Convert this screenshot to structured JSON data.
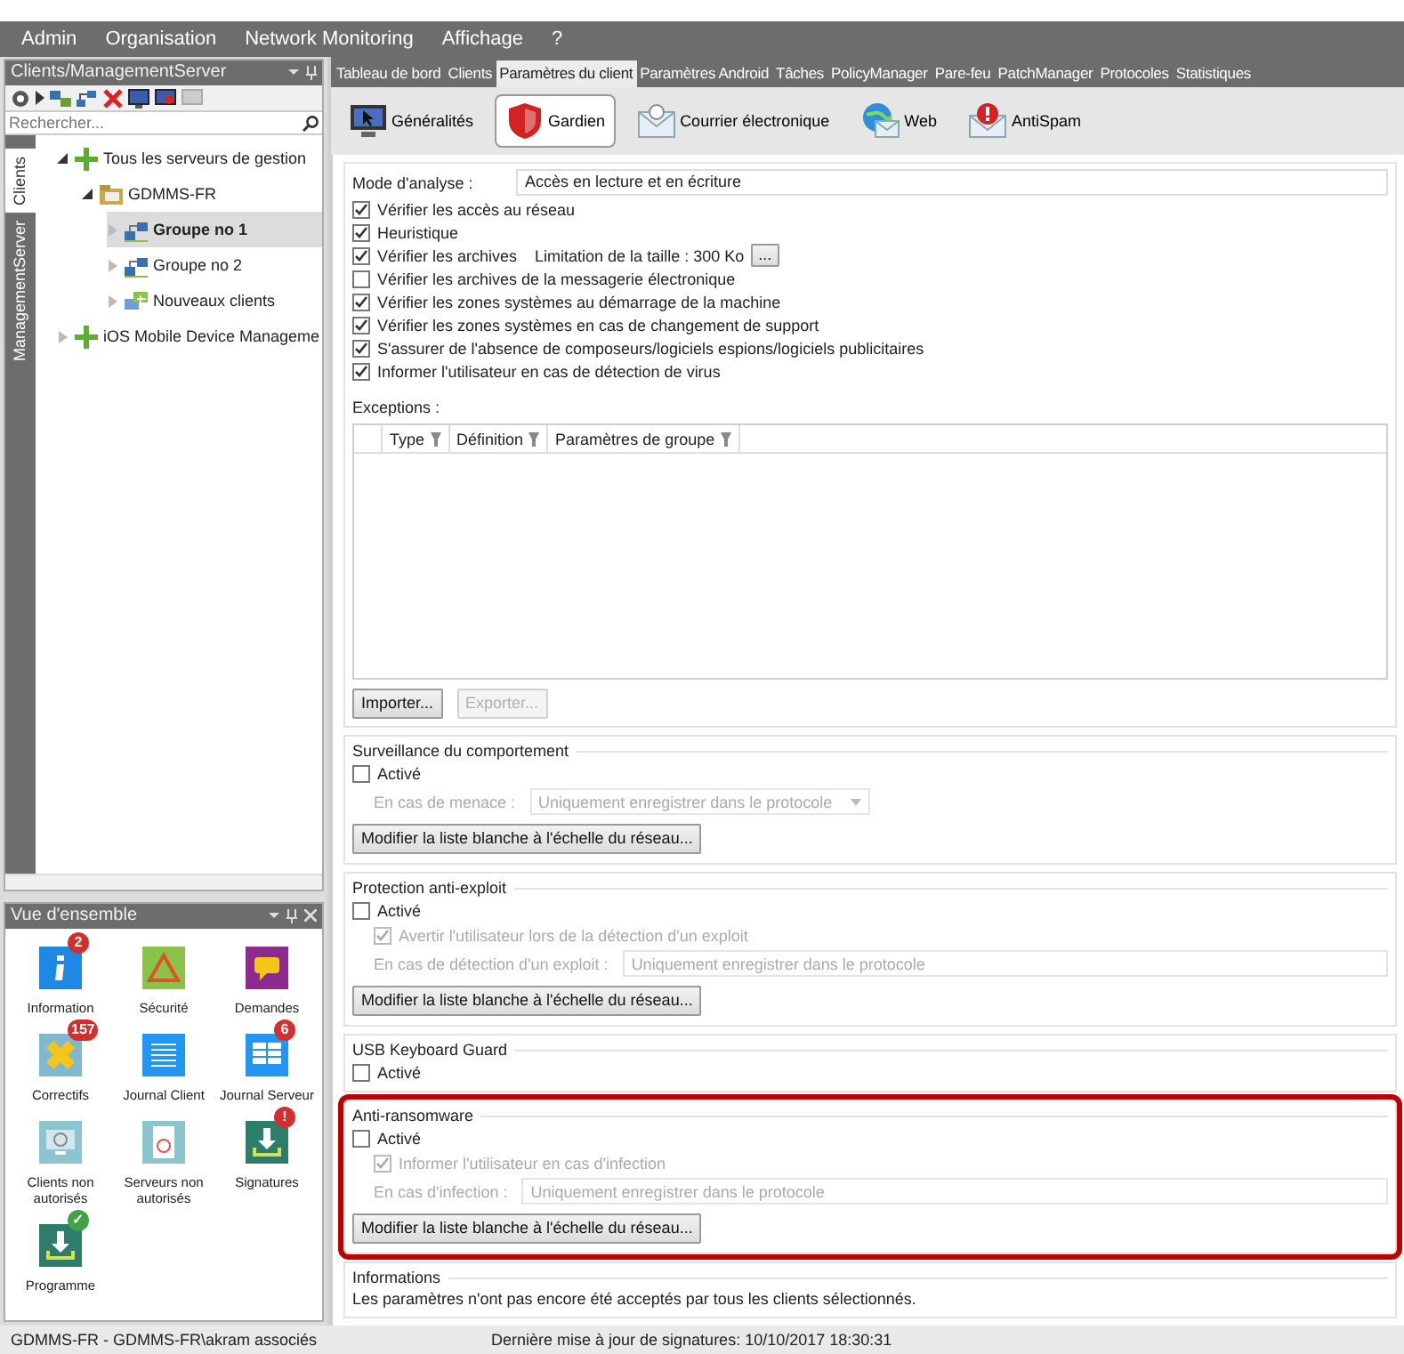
{
  "menu": [
    "Admin",
    "Organisation",
    "Network Monitoring",
    "Affichage",
    "?"
  ],
  "clients_panel": {
    "title": "Clients/ManagementServer",
    "search": {
      "placeholder": "Rechercher..."
    },
    "side_tabs": [
      {
        "label": "Clients",
        "selected": true
      },
      {
        "label": "ManagementServer",
        "selected": false
      }
    ],
    "tree": [
      {
        "label": "Tous les serveurs de gestion",
        "kind": "server-group",
        "expanded": true,
        "selected": false,
        "children": [
          {
            "label": "GDMMS-FR",
            "kind": "folder",
            "expanded": true,
            "selected": false,
            "children": [
              {
                "label": "Groupe no 1",
                "kind": "group",
                "expanded": false,
                "selected": true
              },
              {
                "label": "Groupe no 2",
                "kind": "group",
                "expanded": false,
                "selected": false
              },
              {
                "label": "Nouveaux clients",
                "kind": "new-clients",
                "expanded": false,
                "selected": false
              }
            ]
          }
        ]
      },
      {
        "label": "iOS Mobile Device Manageme",
        "kind": "server-group",
        "expanded": false,
        "selected": false
      }
    ]
  },
  "overview_panel": {
    "title": "Vue d'ensemble",
    "tiles": [
      {
        "label": "Information",
        "kind": "info",
        "color": "#1e88e5",
        "badge": {
          "text": "2",
          "kind": "alert"
        }
      },
      {
        "label": "Sécurité",
        "kind": "warning",
        "color": "#8bc34a"
      },
      {
        "label": "Demandes",
        "kind": "chat",
        "color": "#8e2a8e"
      },
      {
        "label": "Correctifs",
        "kind": "patch",
        "color": "#7fb8d0",
        "badge": {
          "text": "157",
          "kind": "alert"
        }
      },
      {
        "label": "Journal Client",
        "kind": "list",
        "color": "#2196f3"
      },
      {
        "label": "Journal Serveur",
        "kind": "table",
        "color": "#2196f3",
        "badge": {
          "text": "6",
          "kind": "alert"
        }
      },
      {
        "label": "Clients non autorisés",
        "kind": "monitor-blocked",
        "color": "#8cc4d0"
      },
      {
        "label": "Serveurs non autorisés",
        "kind": "doc-blocked",
        "color": "#8cc4d0"
      },
      {
        "label": "Signatures",
        "kind": "download",
        "color": "#2e7d6b",
        "badge": {
          "text": "!",
          "kind": "alert"
        }
      },
      {
        "label": "Programme",
        "kind": "download",
        "color": "#2e7d6b",
        "badge": {
          "text": "✓",
          "kind": "ok"
        }
      }
    ]
  },
  "main_tabs": [
    {
      "label": "Tableau de bord",
      "selected": false
    },
    {
      "label": "Clients",
      "selected": false
    },
    {
      "label": "Paramètres du client",
      "selected": true
    },
    {
      "label": "Paramètres Android",
      "selected": false
    },
    {
      "label": "Tâches",
      "selected": false
    },
    {
      "label": "PolicyManager",
      "selected": false
    },
    {
      "label": "Pare-feu",
      "selected": false
    },
    {
      "label": "PatchManager",
      "selected": false
    },
    {
      "label": "Protocoles",
      "selected": false
    },
    {
      "label": "Statistiques",
      "selected": false
    }
  ],
  "sub_tabs": [
    {
      "label": "Généralités",
      "kind": "general",
      "selected": false
    },
    {
      "label": "Gardien",
      "kind": "guard",
      "selected": true
    },
    {
      "label": "Courrier électronique",
      "kind": "mail",
      "selected": false
    },
    {
      "label": "Web",
      "kind": "web",
      "selected": false
    },
    {
      "label": "AntiSpam",
      "kind": "antispam",
      "selected": false
    }
  ],
  "scan_mode": {
    "label": "Mode d'analyse :",
    "value": "Accès en lecture et en écriture"
  },
  "options": [
    {
      "label": "Vérifier les accès au réseau",
      "checked": true
    },
    {
      "label": "Heuristique",
      "checked": true
    },
    {
      "label": "Vérifier les archives",
      "checked": true,
      "extra": "Limitation de la taille : 300 Ko",
      "extra_button": "..."
    },
    {
      "label": "Vérifier les archives de la messagerie électronique",
      "checked": false
    },
    {
      "label": "Vérifier les zones systèmes au démarrage de la machine",
      "checked": true
    },
    {
      "label": "Vérifier les zones systèmes en cas de changement de support",
      "checked": true
    },
    {
      "label": "S'assurer de l'absence de composeurs/logiciels espions/logiciels publicitaires",
      "checked": true
    },
    {
      "label": "Informer l'utilisateur en cas de détection de virus",
      "checked": true
    }
  ],
  "exceptions": {
    "label": "Exceptions :",
    "columns": [
      "Type",
      "Définition",
      "Paramètres de groupe"
    ],
    "buttons": [
      {
        "label": "Importer...",
        "disabled": false
      },
      {
        "label": "Exporter...",
        "disabled": true
      }
    ]
  },
  "sections": [
    {
      "title": "Surveillance du comportement",
      "highlighted": false,
      "items": [
        {
          "kind": "checkbox",
          "label": "Activé",
          "checked": false,
          "disabled": false
        },
        {
          "kind": "select",
          "label": "En cas de menace :",
          "value": "Uniquement enregistrer dans le protocole",
          "disabled": true,
          "dropdown": true
        },
        {
          "kind": "button",
          "label": "Modifier la liste blanche à l'échelle du réseau..."
        }
      ]
    },
    {
      "title": "Protection anti-exploit",
      "highlighted": false,
      "items": [
        {
          "kind": "checkbox",
          "label": "Activé",
          "checked": false,
          "disabled": false
        },
        {
          "kind": "checkbox",
          "label": "Avertir l'utilisateur lors de la détection d'un exploit",
          "checked": true,
          "disabled": true
        },
        {
          "kind": "select",
          "label": "En cas de détection d'un exploit :",
          "value": "Uniquement enregistrer dans le protocole",
          "disabled": true,
          "dropdown": false
        },
        {
          "kind": "button",
          "label": "Modifier la liste blanche à l'échelle du réseau..."
        }
      ]
    },
    {
      "title": "USB Keyboard Guard",
      "highlighted": false,
      "items": [
        {
          "kind": "checkbox",
          "label": "Activé",
          "checked": false,
          "disabled": false
        }
      ]
    },
    {
      "title": "Anti-ransomware",
      "highlighted": true,
      "items": [
        {
          "kind": "checkbox",
          "label": "Activé",
          "checked": false,
          "disabled": false
        },
        {
          "kind": "checkbox",
          "label": "Informer l'utilisateur en cas d'infection",
          "checked": true,
          "disabled": true
        },
        {
          "kind": "select",
          "label": "En cas d'infection :",
          "value": "Uniquement enregistrer dans le protocole",
          "disabled": true,
          "dropdown": false
        },
        {
          "kind": "button",
          "label": "Modifier la liste blanche à l'échelle du réseau..."
        }
      ]
    },
    {
      "title": "Informations",
      "highlighted": false,
      "items": [
        {
          "kind": "text",
          "label": "Les paramètres n'ont pas encore été acceptés par tous les clients sélectionnés."
        }
      ]
    }
  ],
  "status_bar": {
    "left": "GDMMS-FR - GDMMS-FR\\akram associés",
    "center": "Dernière mise à jour de signatures: 10/10/2017 18:30:31"
  }
}
